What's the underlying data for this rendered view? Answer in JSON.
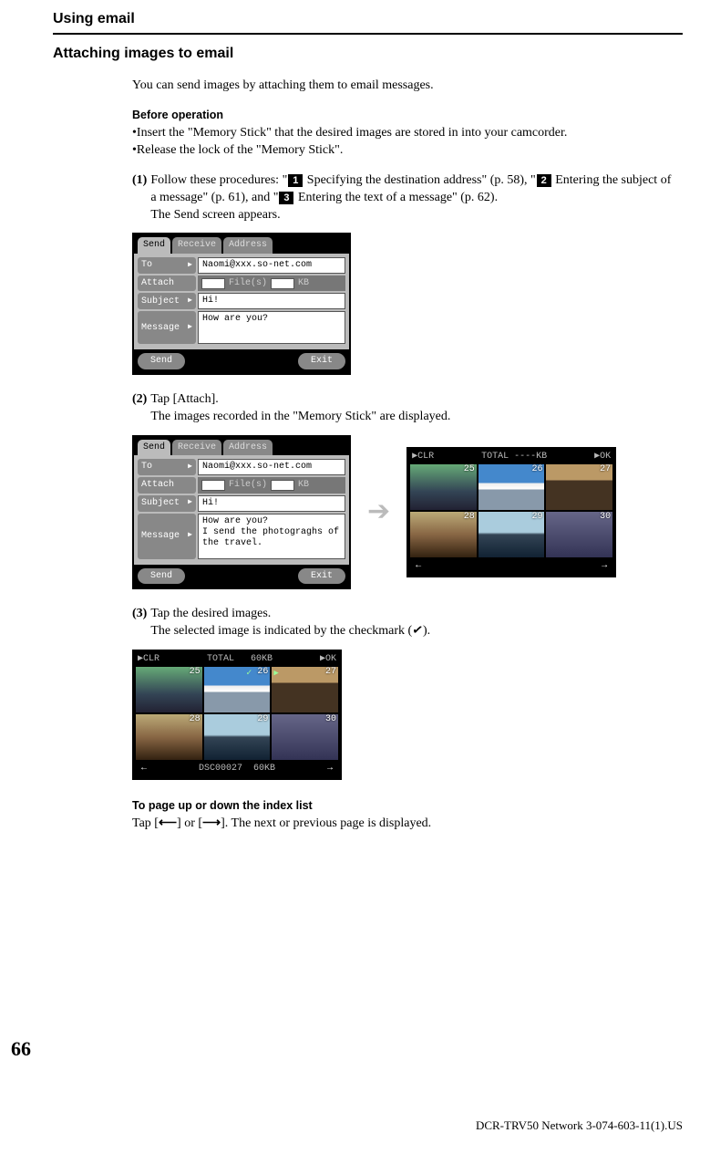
{
  "chapterTitle": "Using email",
  "sectionTitle": "Attaching images to email",
  "intro": "You can send images by attaching them to email messages.",
  "before": {
    "heading": "Before operation",
    "b1": "•Insert the \"Memory Stick\" that the desired images are stored in into your camcorder.",
    "b2": "•Release the lock of the \"Memory Stick\"."
  },
  "step1": {
    "num": "(1)",
    "t1": "Follow these procedures: \"",
    "n1": "1",
    "t2": " Specifying the destination address\" (p. 58), \"",
    "n2": "2",
    "t3": " Entering the subject of a message\" (p. 61), and \"",
    "n3": "3",
    "t4": " Entering the text of a message\" (p. 62).",
    "t5": "The Send screen appears."
  },
  "step2": {
    "num": "(2)",
    "l1": "Tap [Attach].",
    "l2": "The images recorded in the \"Memory Stick\" are displayed."
  },
  "step3": {
    "num": "(3)",
    "l1": "Tap the desired images.",
    "l2a": "The selected image is indicated by the checkmark (",
    "l2b": ")."
  },
  "pageHint": {
    "head": "To page up or down the index list",
    "t1": "Tap [",
    "t2": "] or [",
    "t3": "]. The next or previous page is displayed."
  },
  "cam": {
    "tabs": {
      "send": "Send",
      "receive": "Receive",
      "address": "Address"
    },
    "labels": {
      "to": "To",
      "attach": "Attach",
      "subject": "Subject",
      "message": "Message"
    },
    "toVal": "Naomi@xxx.so-net.com",
    "filesLabel": "File(s)",
    "kbLabel": "KB",
    "subjectVal": "Hi!",
    "msg1": "How are you?",
    "msg2": "How are you?\nI send the photograghs of the travel.",
    "btnSend": "Send",
    "btnExit": "Exit"
  },
  "gridA": {
    "clr": "▶CLR",
    "totalLabel": "TOTAL ----KB",
    "ok": "▶OK",
    "nums": [
      "25",
      "26",
      "27",
      "28",
      "29",
      "30"
    ]
  },
  "gridB": {
    "clr": "▶CLR",
    "totalLabel": "TOTAL",
    "kb": "60KB",
    "ok": "▶OK",
    "nums": [
      "25",
      "26",
      "27",
      "28",
      "29",
      "30"
    ],
    "file": "DSC00027",
    "size": "60KB"
  },
  "pageNum": "66",
  "footer": "DCR-TRV50 Network 3-074-603-11(1).US"
}
